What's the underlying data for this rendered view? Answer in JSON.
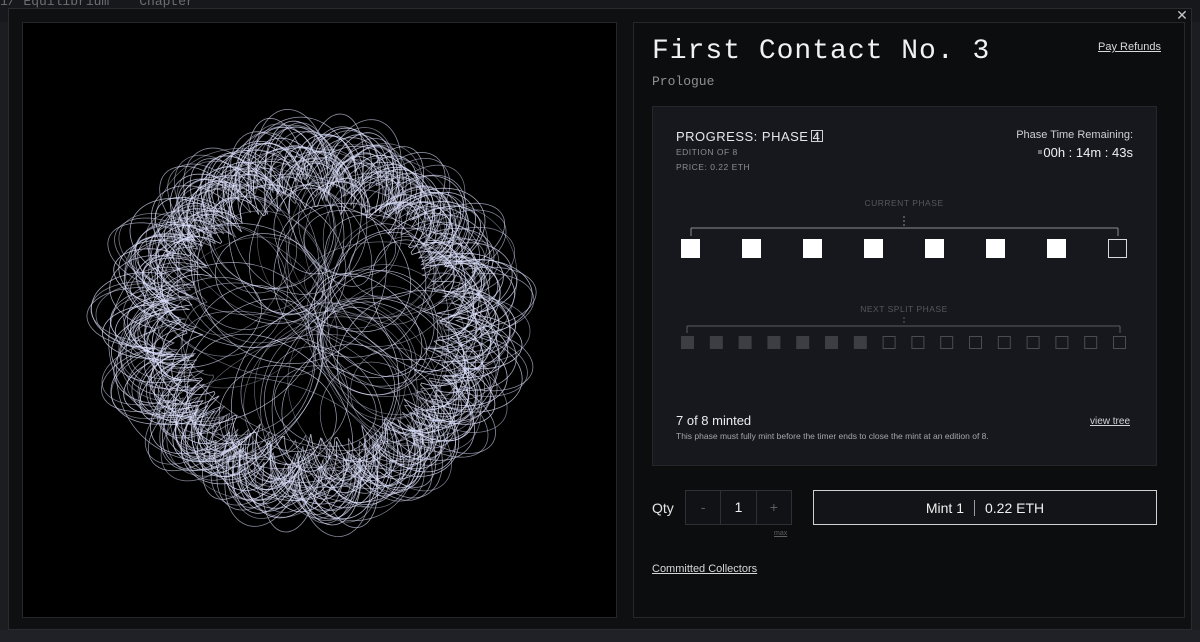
{
  "backdrop": {
    "left_text": "1/ Equilibrium",
    "right_text": "Chapter"
  },
  "modal": {
    "close_glyph": "✕"
  },
  "artwork": {
    "background": "#000000",
    "stroke_color": "#dfe3ff"
  },
  "info": {
    "title": "First Contact No. 3",
    "subtitle": "Prologue",
    "refunds_label": "Pay Refunds"
  },
  "progress": {
    "label": "PROGRESS: PHASE 4",
    "info_glyph": "i",
    "edition": "EDITION OF 8",
    "price": "PRICE: 0.22 ETH",
    "time_label": "Phase Time Remaining:",
    "time_value": "00h : 14m : 43s",
    "current_phase_caption": "CURRENT PHASE",
    "next_phase_caption": "NEXT SPLIT PHASE",
    "current_phase_slots": 8,
    "current_phase_filled": 7,
    "next_phase_slots": 16,
    "next_phase_filled": 7,
    "minted_text": "7 of 8 minted",
    "minted_note": "This phase must fully mint before the timer ends to close the mint at an edition of 8.",
    "tree_link": "view tree"
  },
  "purchase": {
    "qty_label": "Qty",
    "minus": "-",
    "quantity": "1",
    "plus": "+",
    "max_label": "max",
    "mint_label": "Mint 1",
    "mint_price": "0.22 ETH"
  },
  "footer": {
    "collectors_link": "Committed Collectors"
  },
  "colors": {
    "filled_slot": "#ffffff",
    "empty_slot_border": "#d8d9dc",
    "next_filled_slot": "#3c3e44",
    "next_empty_border": "#4a4c52"
  }
}
